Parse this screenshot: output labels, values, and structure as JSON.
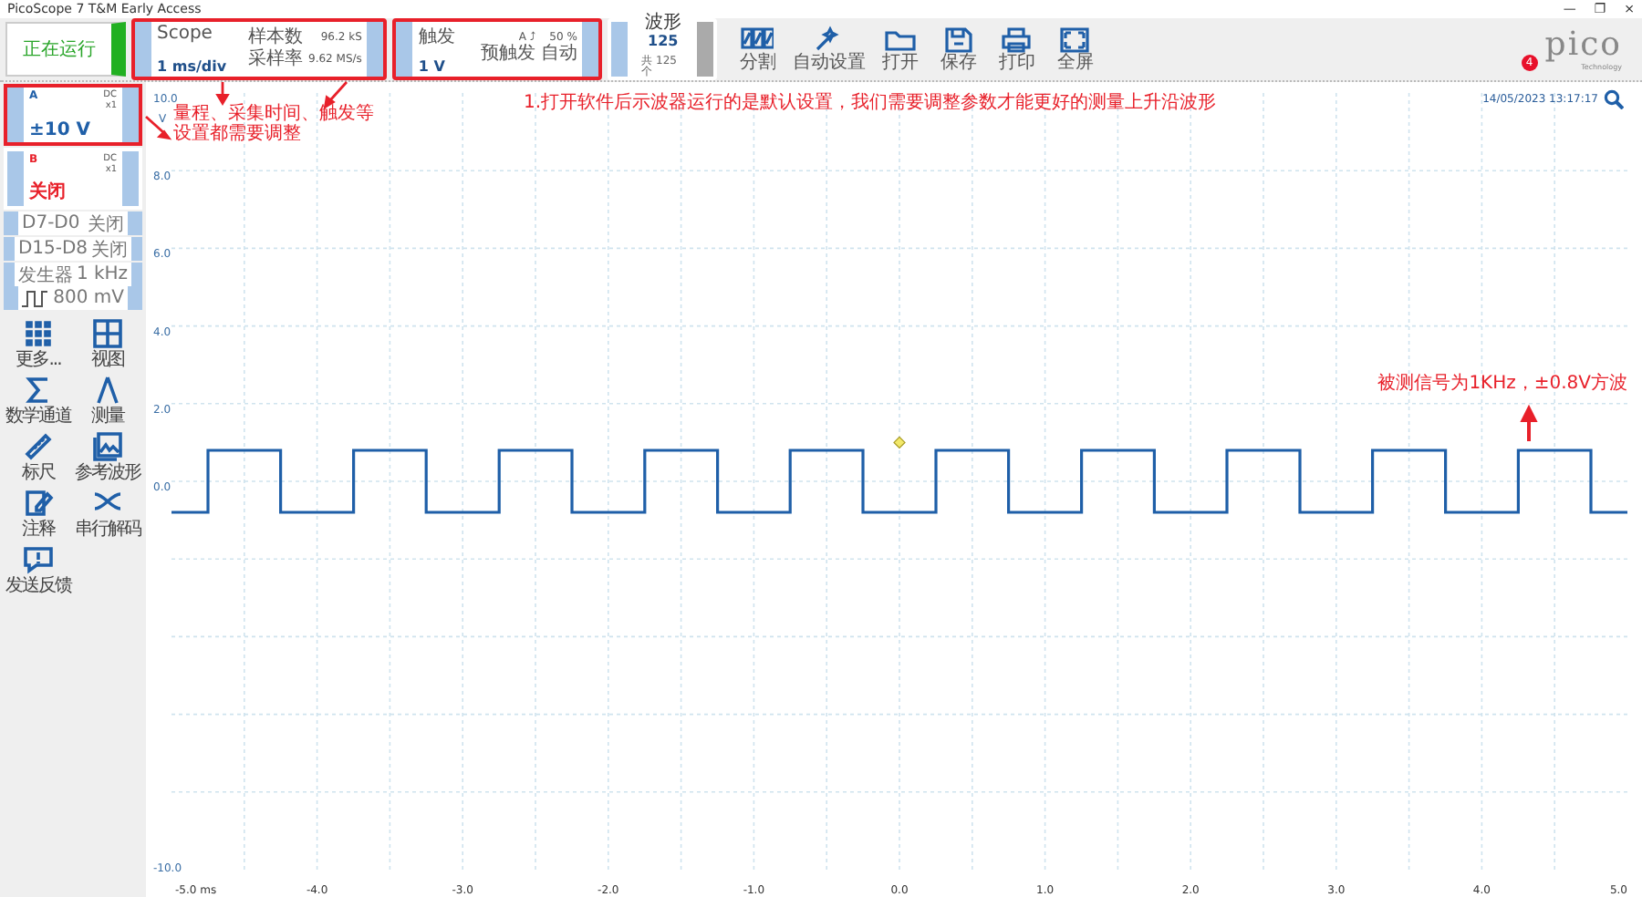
{
  "window": {
    "title": "PicoScope 7 T&M Early Access",
    "controls": [
      "—",
      "❐",
      "×"
    ]
  },
  "run_button": {
    "label": "正在运行",
    "running": true
  },
  "timebase": {
    "label": "Scope",
    "value": "1 ms/div",
    "info": [
      "样本数",
      "96.2 kS",
      "采样率",
      "9.62 MS/s"
    ],
    "highlighted": true
  },
  "trigger": {
    "label": "触发",
    "value": "1 V",
    "info": [
      "A ⤴",
      "50 %",
      "预触发",
      "自动"
    ],
    "highlighted": true
  },
  "waveforms": {
    "label": "波形",
    "value": "125",
    "note": "共 125 个"
  },
  "toolbar": [
    "分割",
    "自动设置",
    "打开",
    "保存",
    "打印",
    "全屏"
  ],
  "notification_count": "4",
  "logo": {
    "name": "pico",
    "tagline": "Technology"
  },
  "channels": [
    {
      "name": "A",
      "coupling": "DC",
      "probe": "x1",
      "range": "±10 V",
      "color": "#1f5fa8",
      "highlighted": true
    },
    {
      "name": "B",
      "coupling": "DC",
      "probe": "x1",
      "range": "关闭",
      "color": "#e8202a",
      "highlighted": false
    }
  ],
  "digital": [
    {
      "label": "D7-D0",
      "value": "关闭"
    },
    {
      "label": "D15-D8",
      "value": "关闭"
    }
  ],
  "generator": {
    "label": "发生器",
    "frequency": "1 kHz",
    "amplitude": "800 mV"
  },
  "tools": [
    "更多...",
    "视图",
    "数学通道",
    "测量",
    "标尺",
    "参考波形",
    "注释",
    "串行解码",
    "发送反馈"
  ],
  "notes": {
    "settings": [
      "量程、采集时间、触发等",
      "设置都需要调整"
    ],
    "intro": "1.打开软件后示波器运行的是默认设置，我们需要调整参数才能更好的测量上升沿波形",
    "signal": "被测信号为1KHz，±0.8V方波"
  },
  "plot": {
    "timestamp": "14/05/2023 13:17:17",
    "y_unit": "V",
    "chart_data": {
      "type": "line",
      "x": [
        -5,
        -4.75,
        -4.75,
        -4.25,
        -4.25,
        -3.75,
        -3.75,
        -3.25,
        -3.25,
        -2.75,
        -2.75,
        -2.25,
        -2.25,
        -1.75,
        -1.75,
        -1.25,
        -1.25,
        -0.75,
        -0.75,
        -0.25,
        -0.25,
        0.25,
        0.25,
        0.75,
        0.75,
        1.25,
        1.25,
        1.75,
        1.75,
        2.25,
        2.25,
        2.75,
        2.75,
        3.25,
        3.25,
        3.75,
        3.75,
        4.25,
        4.25,
        4.75,
        4.75,
        5
      ],
      "grid": true,
      "series": [
        {
          "color": "#1f5fa8",
          "values": [
            -0.8,
            -0.8,
            0.8,
            0.8,
            -0.8,
            -0.8,
            0.8,
            0.8,
            -0.8,
            -0.8,
            0.8,
            0.8,
            -0.8,
            -0.8,
            0.8,
            0.8,
            -0.8,
            -0.8,
            0.8,
            0.8,
            -0.8,
            -0.8,
            0.8,
            0.8,
            -0.8,
            -0.8,
            0.8,
            0.8,
            -0.8,
            -0.8,
            0.8,
            0.8,
            -0.8,
            -0.8,
            0.8,
            0.8,
            -0.8,
            -0.8,
            0.8,
            0.8,
            -0.8,
            -0.8
          ]
        }
      ],
      "xlim": [
        -5,
        5
      ],
      "ylim": [
        -10,
        10
      ],
      "xticks": [
        {
          "value": -5,
          "label": "-5.0 ms"
        },
        {
          "value": -4,
          "label": "-4.0"
        },
        {
          "value": -3,
          "label": "-3.0"
        },
        {
          "value": -2,
          "label": "-2.0"
        },
        {
          "value": -1,
          "label": "-1.0"
        },
        {
          "value": 0,
          "label": "0.0"
        },
        {
          "value": 1,
          "label": "1.0"
        },
        {
          "value": 2,
          "label": "2.0"
        },
        {
          "value": 3,
          "label": "3.0"
        },
        {
          "value": 4,
          "label": "4.0"
        },
        {
          "value": 5,
          "label": "5.0"
        }
      ],
      "yticks": [
        {
          "value": 10,
          "label": "10.0"
        },
        {
          "value": 8,
          "label": "8.0"
        },
        {
          "value": 6,
          "label": "6.0"
        },
        {
          "value": 4,
          "label": "4.0"
        },
        {
          "value": 2,
          "label": "2.0"
        },
        {
          "value": 0,
          "label": "0.0"
        },
        {
          "value": -10,
          "label": "-10.0"
        }
      ]
    }
  }
}
